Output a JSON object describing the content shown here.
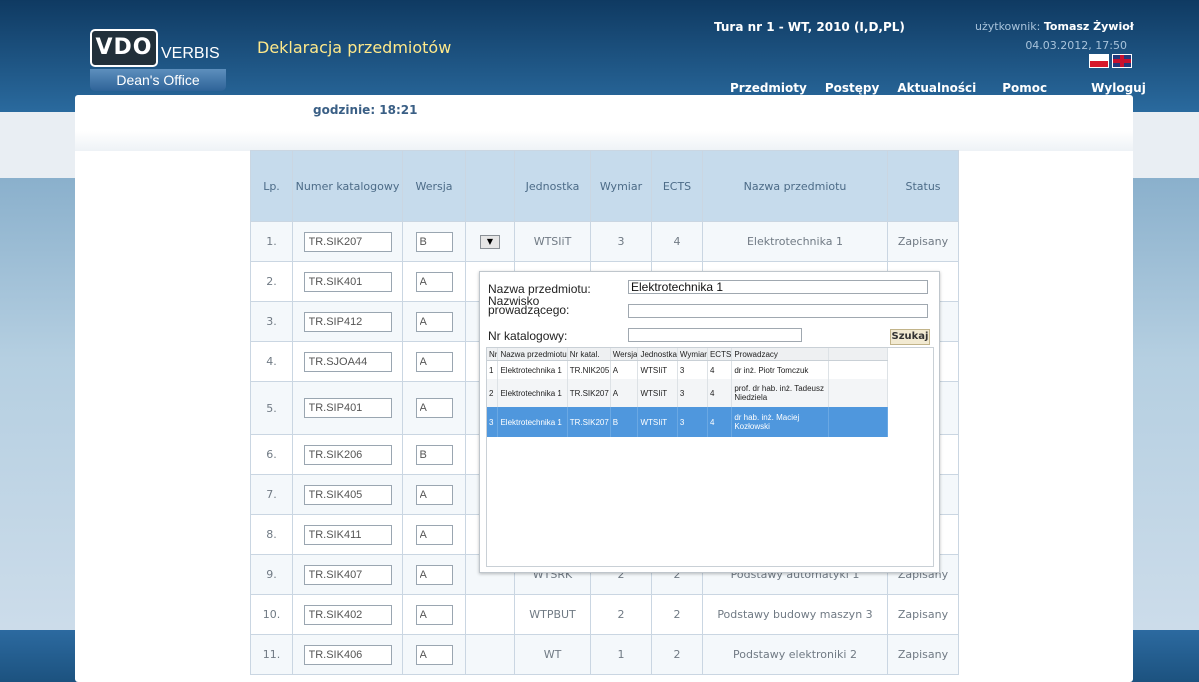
{
  "header": {
    "logo_vdo": "VDO",
    "logo_verbis": "VERBIS",
    "logo_dean": "Dean's Office",
    "app_title": "Deklaracja przedmiotów",
    "tura": "Tura nr 1 - WT, 2010 (I,D,PL)",
    "user_label": "użytkownik:",
    "user_name": "Tomasz Żywioł",
    "datetime": "04.03.2012, 17:50",
    "nav": [
      "Przedmioty",
      "Postępy",
      "Aktualności",
      "Pomoc",
      "Wyloguj"
    ]
  },
  "clock": "godzinie: 18:21",
  "table": {
    "headers": [
      "Lp.",
      "Numer katalogowy",
      "Wersja",
      "",
      "Jednostka",
      "Wymiar",
      "ECTS",
      "Nazwa przedmiotu",
      "Status"
    ],
    "rows": [
      {
        "lp": "1.",
        "cat": "TR.SIK207",
        "ver": "B",
        "unit": "WTSIiT",
        "wym": "3",
        "ects": "4",
        "name": "Elektrotechnika 1",
        "status": "Zapisany"
      },
      {
        "lp": "2.",
        "cat": "TR.SIK401",
        "ver": "A",
        "unit": "",
        "wym": "",
        "ects": "",
        "name": "",
        "status": ""
      },
      {
        "lp": "3.",
        "cat": "TR.SIP412",
        "ver": "A",
        "unit": "",
        "wym": "",
        "ects": "",
        "name": "",
        "status": ""
      },
      {
        "lp": "4.",
        "cat": "TR.SJOA44",
        "ver": "A",
        "unit": "",
        "wym": "",
        "ects": "",
        "name": "",
        "status": ""
      },
      {
        "lp": "5.",
        "cat": "TR.SIP401",
        "ver": "A",
        "unit": "",
        "wym": "",
        "ects": "",
        "name": "",
        "status": ""
      },
      {
        "lp": "6.",
        "cat": "TR.SIK206",
        "ver": "B",
        "unit": "",
        "wym": "",
        "ects": "",
        "name": "",
        "status": ""
      },
      {
        "lp": "7.",
        "cat": "TR.SIK405",
        "ver": "A",
        "unit": "",
        "wym": "",
        "ects": "",
        "name": "",
        "status": ""
      },
      {
        "lp": "8.",
        "cat": "TR.SIK411",
        "ver": "A",
        "unit": "",
        "wym": "",
        "ects": "",
        "name": "",
        "status": ""
      },
      {
        "lp": "9.",
        "cat": "TR.SIK407",
        "ver": "A",
        "unit": "WTSRK",
        "wym": "2",
        "ects": "2",
        "name": "Podstawy automatyki 1",
        "status": "Zapisany"
      },
      {
        "lp": "10.",
        "cat": "TR.SIK402",
        "ver": "A",
        "unit": "WTPBUT",
        "wym": "2",
        "ects": "2",
        "name": "Podstawy budowy maszyn 3",
        "status": "Zapisany"
      },
      {
        "lp": "11.",
        "cat": "TR.SIK406",
        "ver": "A",
        "unit": "WT",
        "wym": "1",
        "ects": "2",
        "name": "Podstawy elektroniki 2",
        "status": "Zapisany"
      }
    ]
  },
  "popup": {
    "label_name": "Nazwa przedmiotu:",
    "label_teacher": "Nazwisko prowadzącego:",
    "label_cat": "Nr katalogowy:",
    "name_value": "Elektrotechnika 1",
    "teacher_value": "",
    "cat_value": "",
    "search_button": "Szukaj",
    "grid_headers": [
      "Nr",
      "Nazwa przedmiotu",
      "Nr katal.",
      "Wersja",
      "Jednostka",
      "Wymiar",
      "ECTS",
      "Prowadzacy"
    ],
    "grid_rows": [
      {
        "nr": "1",
        "name": "Elektrotechnika 1",
        "cat": "TR.NIK205",
        "ver": "A",
        "unit": "WTSIiT",
        "wym": "3",
        "ects": "4",
        "teacher": "dr inż. Piotr Tomczuk"
      },
      {
        "nr": "2",
        "name": "Elektrotechnika 1",
        "cat": "TR.SIK207",
        "ver": "A",
        "unit": "WTSIiT",
        "wym": "3",
        "ects": "4",
        "teacher": "prof. dr hab. inż. Tadeusz Niedziela"
      },
      {
        "nr": "3",
        "name": "Elektrotechnika 1",
        "cat": "TR.SIK207",
        "ver": "B",
        "unit": "WTSIiT",
        "wym": "3",
        "ects": "4",
        "teacher": "dr hab. inż. Maciej Kozłowski"
      }
    ]
  }
}
